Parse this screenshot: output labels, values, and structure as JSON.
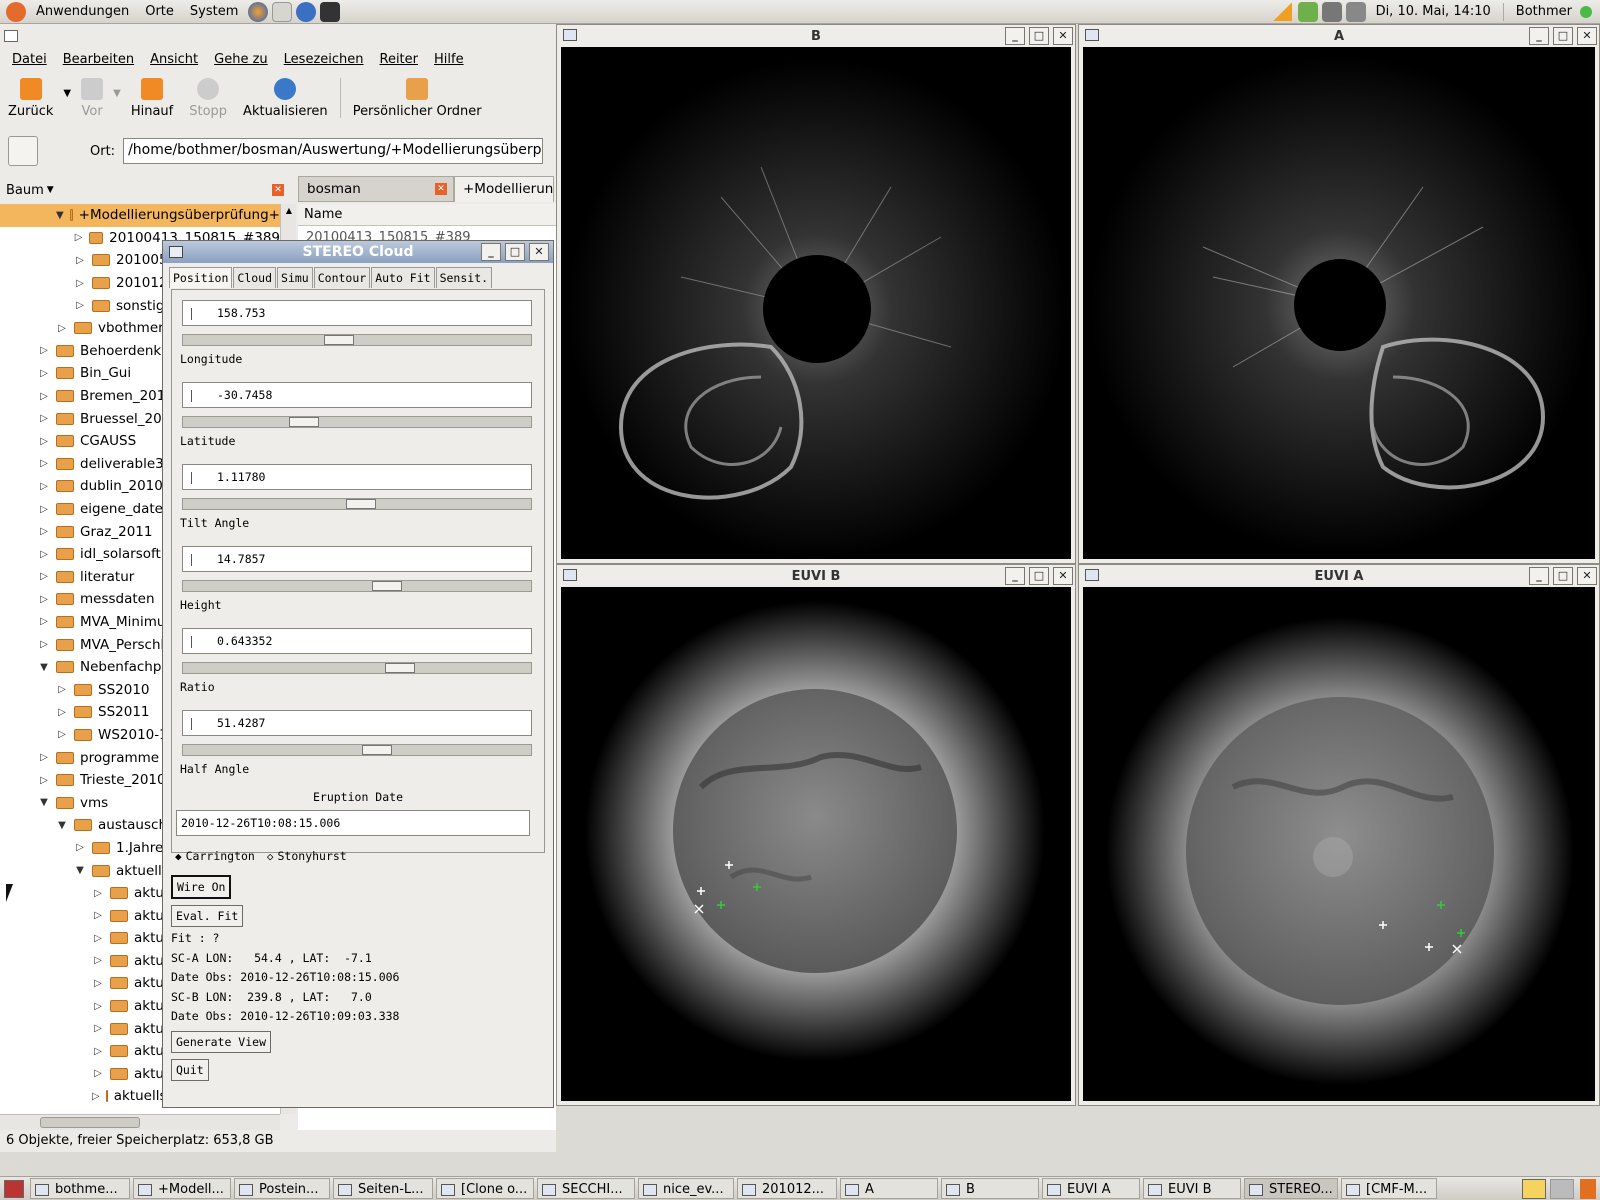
{
  "top_panel": {
    "menus": [
      "Anwendungen",
      "Orte",
      "System"
    ],
    "clock": "Di, 10. Mai, 14:10",
    "user": "Bothmer"
  },
  "file_manager": {
    "menu": [
      "Datei",
      "Bearbeiten",
      "Ansicht",
      "Gehe zu",
      "Lesezeichen",
      "Reiter",
      "Hilfe"
    ],
    "toolbar": {
      "back": "Zurück",
      "forward": "Vor",
      "up": "Hinauf",
      "stop": "Stopp",
      "reload": "Aktualisieren",
      "home": "Persönlicher Ordner"
    },
    "location_label": "Ort:",
    "location_value": "/home/bothmer/bosman/Auswertung/+Modellierungsüberprüfung+",
    "side_mode": "Baum",
    "tree": [
      {
        "label": "+Modellierungsüberprüfung+",
        "level": 3,
        "expanded": true,
        "selected": true
      },
      {
        "label": "20100413_150815_#389",
        "level": 4
      },
      {
        "label": "20100524_...",
        "level": 4
      },
      {
        "label": "20101226_...",
        "level": 4
      },
      {
        "label": "sonstige...",
        "level": 4
      },
      {
        "label": "vbothmer-j...",
        "level": 3
      },
      {
        "label": "Behoerdenkra...",
        "level": 2
      },
      {
        "label": "Bin_Gui",
        "level": 2
      },
      {
        "label": "Bremen_2010",
        "level": 2
      },
      {
        "label": "Bruessel_201...",
        "level": 2
      },
      {
        "label": "CGAUSS",
        "level": 2
      },
      {
        "label": "deliverable3.2...",
        "level": 2
      },
      {
        "label": "dublin_2010",
        "level": 2
      },
      {
        "label": "eigene_dateie...",
        "level": 2
      },
      {
        "label": "Graz_2011",
        "level": 2
      },
      {
        "label": "idl_solarsoft",
        "level": 2
      },
      {
        "label": "literatur",
        "level": 2
      },
      {
        "label": "messdaten",
        "level": 2
      },
      {
        "label": "MVA_Minimum...",
        "level": 2
      },
      {
        "label": "MVA_Perschke...",
        "level": 2
      },
      {
        "label": "Nebenfachpra...",
        "level": 2,
        "expanded": true
      },
      {
        "label": "SS2010",
        "level": 3
      },
      {
        "label": "SS2011",
        "level": 3
      },
      {
        "label": "WS2010-11...",
        "level": 3
      },
      {
        "label": "programme",
        "level": 2
      },
      {
        "label": "Trieste_2010",
        "level": 2
      },
      {
        "label": "vms",
        "level": 2,
        "expanded": true
      },
      {
        "label": "austausch",
        "level": 3,
        "expanded": true
      },
      {
        "label": "1.Jahres...",
        "level": 4
      },
      {
        "label": "aktuelle_...",
        "level": 4,
        "expanded": true
      },
      {
        "label": "aktue...",
        "level": 5
      },
      {
        "label": "aktue...",
        "level": 5
      },
      {
        "label": "aktue...",
        "level": 5
      },
      {
        "label": "aktue...",
        "level": 5
      },
      {
        "label": "aktue...",
        "level": 5
      },
      {
        "label": "aktue...",
        "level": 5
      },
      {
        "label": "aktue...",
        "level": 5
      },
      {
        "label": "aktue...",
        "level": 5
      },
      {
        "label": "aktue...",
        "level": 5
      },
      {
        "label": "aktuellste_ergebnisse_c...",
        "level": 5
      }
    ],
    "tabs": [
      "bosman",
      "+Modellierun..."
    ],
    "list_header": "Name",
    "list_first": "20100413_150815_#389",
    "status": "6 Objekte, freier Speicherplatz: 653,8 GB"
  },
  "windows": {
    "cor_b": "B",
    "cor_a": "A",
    "euvi_b": "EUVI B",
    "euvi_a": "EUVI A"
  },
  "dialog": {
    "title": "STEREO Cloud",
    "tabs": [
      "Position",
      "Cloud",
      "Simu",
      "Contour",
      "Auto Fit",
      "Sensit."
    ],
    "fields": [
      {
        "label": "Longitude",
        "value": "158.753",
        "slider": 0.44
      },
      {
        "label": "Latitude",
        "value": "-30.7458",
        "slider": 0.33
      },
      {
        "label": "Tilt Angle",
        "value": "1.11780",
        "slider": 0.51
      },
      {
        "label": "Height",
        "value": "14.7857",
        "slider": 0.59
      },
      {
        "label": "Ratio",
        "value": "0.643352",
        "slider": 0.63
      },
      {
        "label": "Half Angle",
        "value": "51.4287",
        "slider": 0.56
      }
    ],
    "eruption_label": "Eruption Date",
    "eruption_value": "2010-12-26T10:08:15.006",
    "radio_carrington": "Carrington",
    "radio_stonyhurst": "Stonyhurst",
    "wire_btn": "Wire On",
    "eval_btn": "Eval. Fit",
    "fit": "Fit : ?",
    "sca": "SC-A LON:   54.4 , LAT:  -7.1",
    "sca_date": "Date Obs: 2010-12-26T10:08:15.006",
    "scb": "SC-B LON:  239.8 , LAT:   7.0",
    "scb_date": "Date Obs: 2010-12-26T10:09:03.338",
    "gen_btn": "Generate View",
    "quit_btn": "Quit"
  },
  "taskbar": [
    "bothme...",
    "+Modell...",
    "Postein...",
    "Seiten-L...",
    "[Clone o...",
    "SECCHI...",
    "nice_ev...",
    "201012...",
    "A",
    "B",
    "EUVI A",
    "EUVI B",
    "STEREO...",
    "[CMF-M..."
  ],
  "colors": {
    "selection": "#f3b65d",
    "dialog_title": "#8aa0c0",
    "folder": "#e8a04a"
  }
}
